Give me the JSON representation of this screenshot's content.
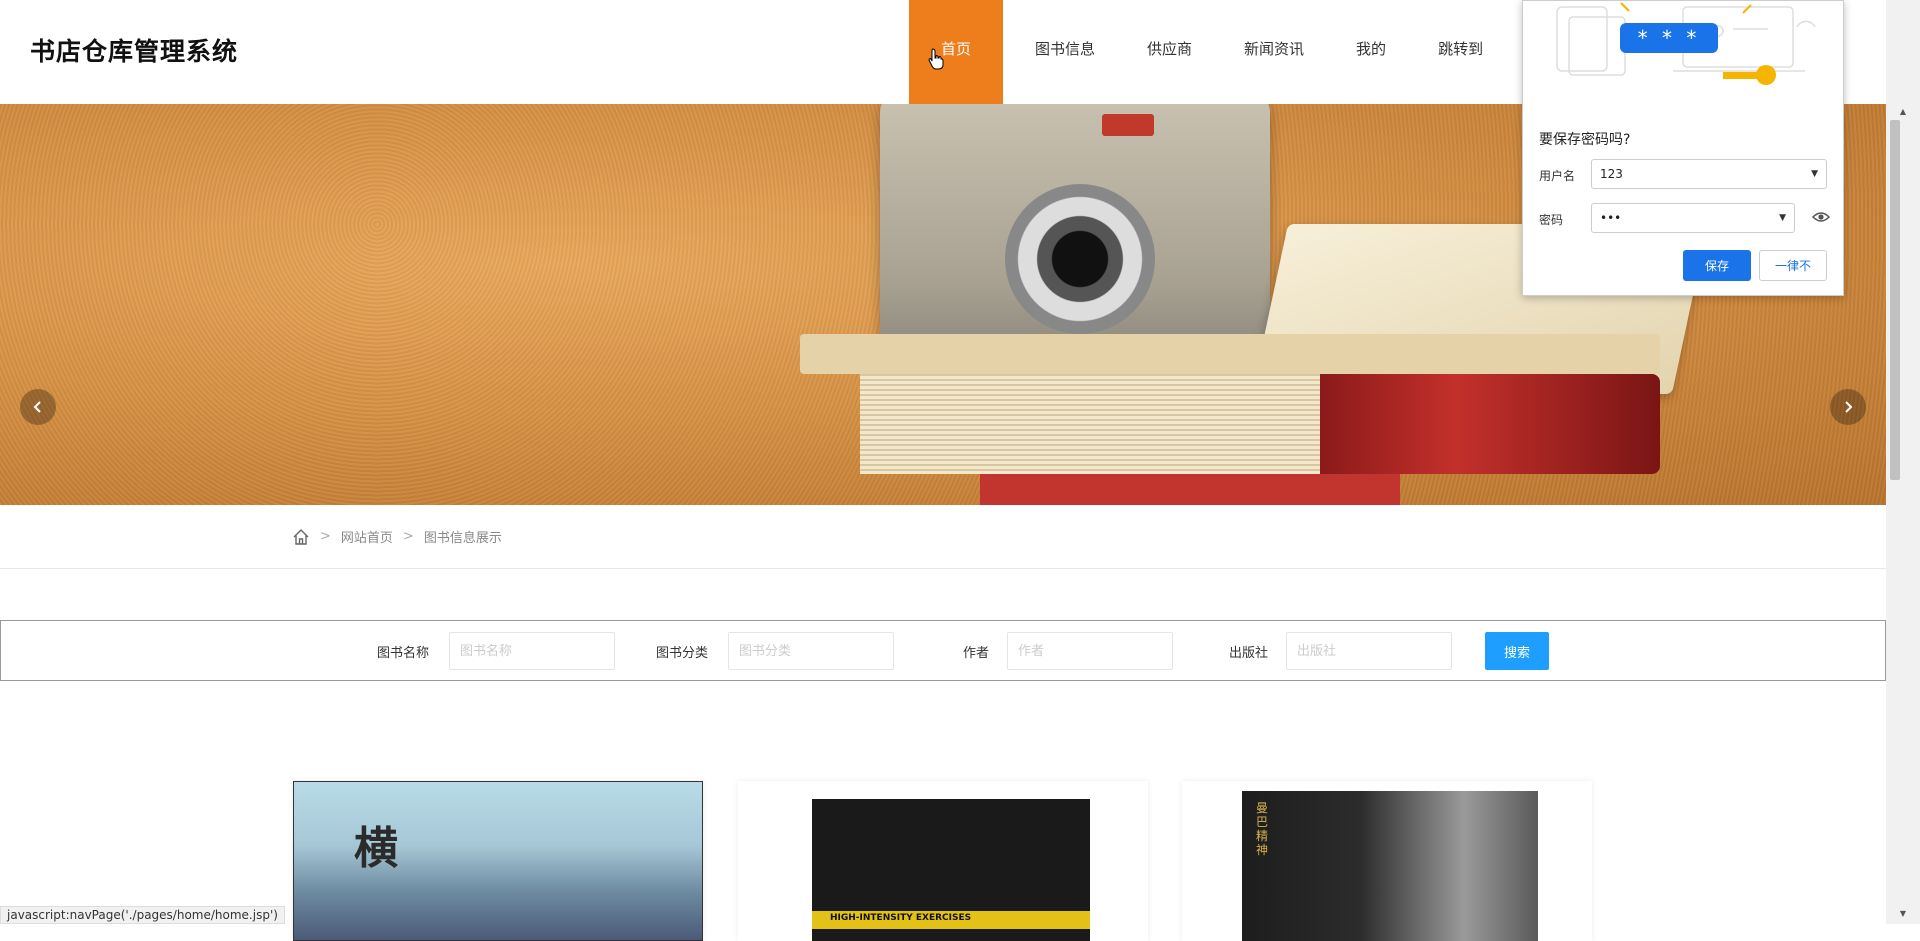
{
  "header": {
    "logo": "书店仓库管理系统",
    "nav": [
      {
        "label": "首页",
        "active": true
      },
      {
        "label": "图书信息"
      },
      {
        "label": "供应商"
      },
      {
        "label": "新闻资讯"
      },
      {
        "label": "我的"
      },
      {
        "label": "跳转到"
      }
    ]
  },
  "banner": {
    "prev_icon": "chevron-left-icon",
    "next_icon": "chevron-right-icon",
    "slide_count": 3,
    "active_slide": 1
  },
  "breadcrumb": {
    "home_icon": "home-icon",
    "items": [
      "网站首页",
      "图书信息展示"
    ]
  },
  "search": {
    "fields": [
      {
        "label": "图书名称",
        "placeholder": "图书名称",
        "value": ""
      },
      {
        "label": "图书分类",
        "placeholder": "图书分类",
        "value": ""
      },
      {
        "label": "作者",
        "placeholder": "作者",
        "value": ""
      },
      {
        "label": "出版社",
        "placeholder": "出版社",
        "value": ""
      }
    ],
    "button": "搜索",
    "button_color": "#1e9fff"
  },
  "books": [
    {
      "cover_text": "横"
    },
    {
      "cover_text": "HIGH-INTENSITY EXERCISES"
    },
    {
      "cover_text": "曼巴精神"
    }
  ],
  "status_bar": "javascript:navPage('./pages/home/home.jsp')",
  "password_popup": {
    "stars": "* * *",
    "title": "要保存密码吗?",
    "username_label": "用户名",
    "username_value": "123",
    "password_label": "密码",
    "password_value": "•••",
    "save_button": "保存",
    "never_button": "一律不",
    "accent_color": "#1a73e8"
  },
  "colors": {
    "nav_active": "#ee7d1b"
  }
}
